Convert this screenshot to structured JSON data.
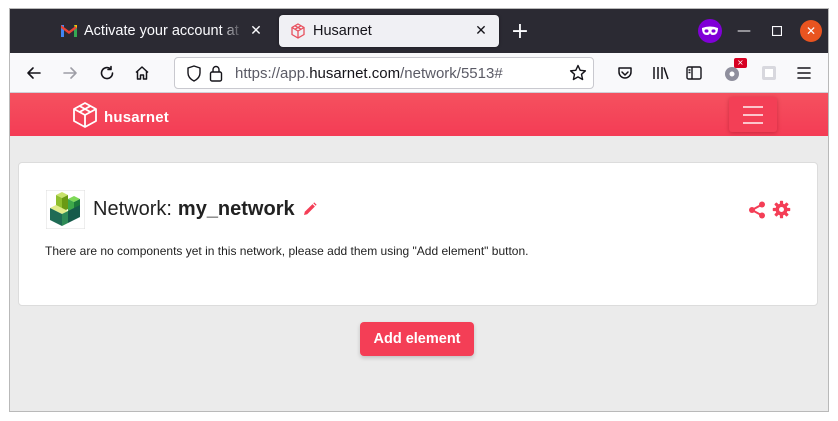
{
  "browser": {
    "tabs": [
      {
        "title": "Activate your account at |",
        "favicon": "gmail-icon",
        "active": false
      },
      {
        "title": "Husarnet",
        "favicon": "husarnet-icon",
        "active": true
      }
    ],
    "new_tab_label": "+",
    "url": {
      "prefix": "https://app.",
      "domain": "husarnet.com",
      "path": "/network/5513#"
    },
    "extension_badge": "×"
  },
  "site": {
    "brand": "husarnet",
    "accent_color": "#f43e56"
  },
  "network": {
    "label": "Network:",
    "name": "my_network",
    "empty_message": "There are no components yet in this network, please add them using \"Add element\" button."
  },
  "actions": {
    "add_element": "Add element"
  }
}
